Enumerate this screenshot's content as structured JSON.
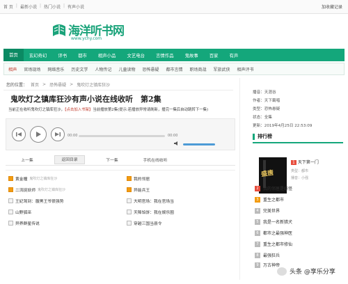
{
  "topbar": {
    "crumbs": [
      "首 页",
      "|",
      "最新小说",
      "|",
      "热门小说",
      "|",
      "有声小说"
    ],
    "favorite": "加收藏记录"
  },
  "logo": {
    "name": "海洋听书网",
    "url": "www.ychy.com"
  },
  "nav": [
    "首页",
    "玄幻奇幻",
    "评书",
    "都市",
    "相声小品",
    "文艺电台",
    "言情作品",
    "鬼故事",
    "百家",
    "有声"
  ],
  "subnav": {
    "lead": "相声",
    "links": [
      "官场现场",
      "网络音乐",
      "历史文学",
      "人物传记",
      "儿童读物",
      "恐怖悬疑",
      "都市言情",
      "职场商战",
      "军旅武侠",
      "相声评书"
    ]
  },
  "location": {
    "label": "您的位置：",
    "path": [
      "首页",
      "恐怖悬疑",
      "鬼吹灯之镇库狂沙"
    ]
  },
  "title": "鬼吹灯之镇库狂沙有声小说在线收听　第2集",
  "notice": {
    "prefix": "当前正在收听鬼吹灯之镇库狂沙，",
    "highlight": "【点击加入书架】",
    "suffix": "当前播放第2集(提示:若播放异常请刷新，播完一集后自动跳转下一集)"
  },
  "player": {
    "time_start": "00:00",
    "time_end": "00:00"
  },
  "tabs": [
    "上一集",
    "返回目录",
    "下一集",
    "手机在线收听"
  ],
  "episodes_left": [
    {
      "label": "黄金瞳",
      "meta": "鬼吹灯之镇库狂沙",
      "hot": true
    },
    {
      "label": "二流捉妖师",
      "meta": "鬼吹灯之镇库狂沙",
      "hot": true
    },
    {
      "label": "王妃驾到：腹黑王爷很强势",
      "meta": "",
      "hot": false
    },
    {
      "label": "山野狐巫",
      "meta": "",
      "hot": false
    },
    {
      "label": "异界群星传说",
      "meta": "",
      "hot": false
    }
  ],
  "episodes_right": [
    {
      "label": "我的邻居",
      "meta": "",
      "hot": true
    },
    {
      "label": "异能兵王",
      "meta": "",
      "hot": true
    },
    {
      "label": "大明官场：我在官场当",
      "meta": "",
      "hot": false
    },
    {
      "label": "天降馅饼：我在娱乐圈",
      "meta": "",
      "hot": false
    },
    {
      "label": "穿越三国当县令",
      "meta": "",
      "hot": false
    }
  ],
  "info": [
    "播音：天涯谷",
    "作者：天下霸唱",
    "类型：恐怖悬疑",
    "状态：全集",
    "更新：2019年4月25日 22:53:09"
  ],
  "rank": {
    "title": "排行榜",
    "top1": "天下第一门",
    "top1_meta1": "类型：都市",
    "top1_meta2": "播音：小强",
    "cover": "盛唐",
    "items": [
      "我的邻居是妖怪",
      "重生之都市",
      "完美世界",
      "我是一名新猎犬",
      "都市之最强神医",
      "重生之都市修仙",
      "最强狂兵",
      "万古神帝"
    ]
  },
  "watermark": "头条 @享乐分享"
}
